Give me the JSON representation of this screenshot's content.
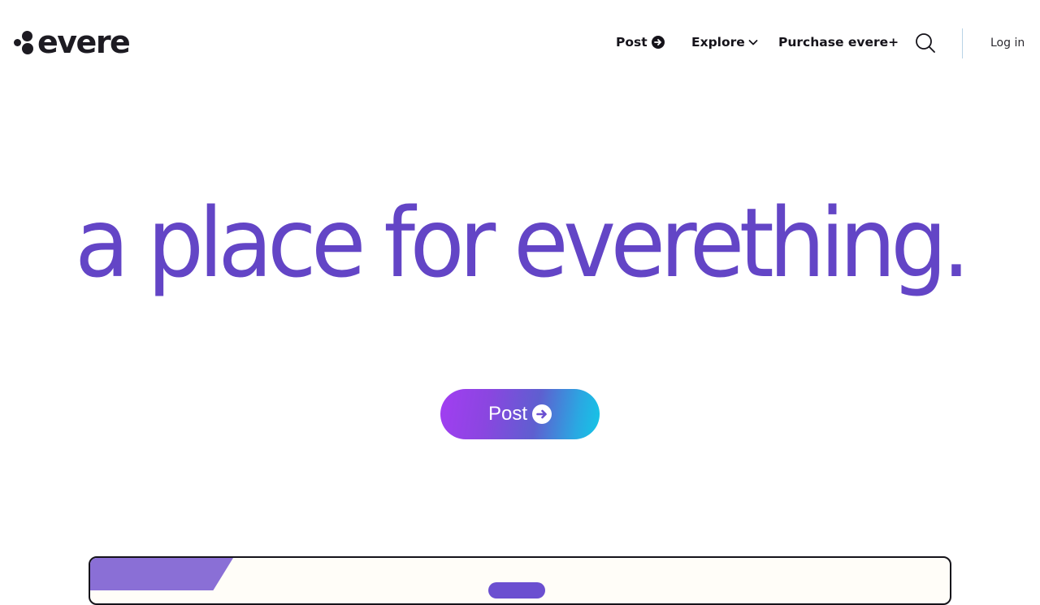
{
  "header": {
    "logo_text": "evere",
    "nav": {
      "post_label": "Post",
      "explore_label": "Explore",
      "purchase_label": "Purchase evere+"
    },
    "search_icon": "search-icon",
    "login_label": "Log in"
  },
  "hero": {
    "headline": "a place for everething."
  },
  "cta": {
    "label": "Post",
    "icon": "arrow-right-circle-icon"
  },
  "colors": {
    "brand_purple": "#6345c6",
    "text_dark": "#15131a",
    "cta_gradient_start": "#a23ef2",
    "cta_gradient_end": "#14c6e6",
    "divider": "#b9d3e6"
  }
}
